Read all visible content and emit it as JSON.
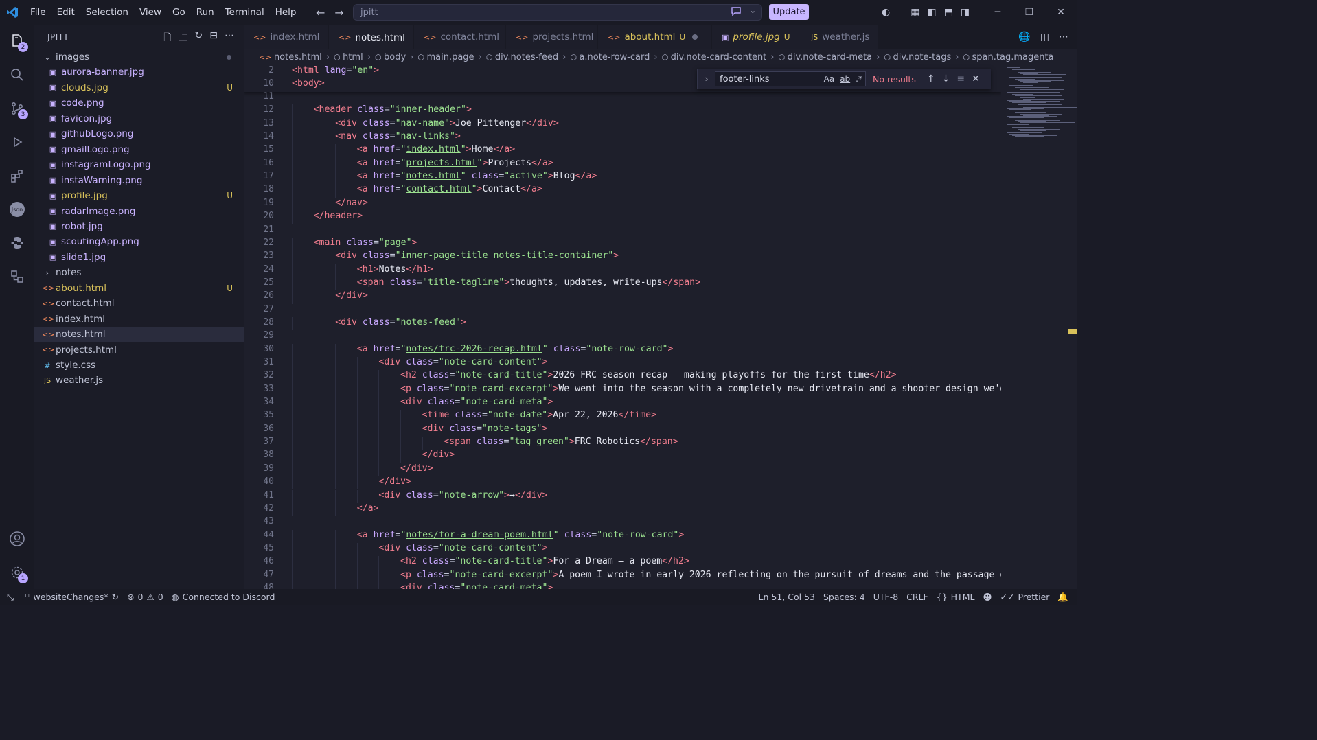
{
  "menu": [
    "File",
    "Edit",
    "Selection",
    "View",
    "Go",
    "Run",
    "Terminal",
    "Help"
  ],
  "command_center": {
    "text": "jpitt"
  },
  "update_label": "Update",
  "activity_badges": {
    "explorer": "2",
    "scm": "3",
    "settings": "1"
  },
  "sidebar": {
    "title": "JPITT",
    "items": [
      {
        "label": "images",
        "kind": "folder-open",
        "status": ""
      },
      {
        "label": "aurora-banner.jpg",
        "kind": "img",
        "status": ""
      },
      {
        "label": "clouds.jpg",
        "kind": "img",
        "status": "U"
      },
      {
        "label": "code.png",
        "kind": "img",
        "status": ""
      },
      {
        "label": "favicon.jpg",
        "kind": "img",
        "status": ""
      },
      {
        "label": "githubLogo.png",
        "kind": "img",
        "status": ""
      },
      {
        "label": "gmailLogo.png",
        "kind": "img",
        "status": ""
      },
      {
        "label": "instagramLogo.png",
        "kind": "img",
        "status": ""
      },
      {
        "label": "instaWarning.png",
        "kind": "img",
        "status": ""
      },
      {
        "label": "profile.jpg",
        "kind": "img",
        "status": "U"
      },
      {
        "label": "radarImage.png",
        "kind": "img",
        "status": ""
      },
      {
        "label": "robot.jpg",
        "kind": "img",
        "status": ""
      },
      {
        "label": "scoutingApp.png",
        "kind": "img",
        "status": ""
      },
      {
        "label": "slide1.jpg",
        "kind": "img",
        "status": ""
      },
      {
        "label": "notes",
        "kind": "folder",
        "status": ""
      },
      {
        "label": "about.html",
        "kind": "html",
        "status": "U"
      },
      {
        "label": "contact.html",
        "kind": "html",
        "status": ""
      },
      {
        "label": "index.html",
        "kind": "html",
        "status": ""
      },
      {
        "label": "notes.html",
        "kind": "html",
        "status": ""
      },
      {
        "label": "projects.html",
        "kind": "html",
        "status": ""
      },
      {
        "label": "style.css",
        "kind": "css",
        "status": ""
      },
      {
        "label": "weather.js",
        "kind": "js",
        "status": ""
      }
    ]
  },
  "tabs": [
    {
      "label": "index.html",
      "kind": "html",
      "state": ""
    },
    {
      "label": "notes.html",
      "kind": "html",
      "state": "modified"
    },
    {
      "label": "contact.html",
      "kind": "html",
      "state": ""
    },
    {
      "label": "projects.html",
      "kind": "html",
      "state": ""
    },
    {
      "label": "about.html",
      "kind": "html",
      "state": "U-dot"
    },
    {
      "label": "profile.jpg",
      "kind": "img",
      "state": "U"
    },
    {
      "label": "weather.js",
      "kind": "js",
      "state": ""
    }
  ],
  "breadcrumb": [
    "notes.html",
    "html",
    "body",
    "main.page",
    "div.notes-feed",
    "a.note-row-card",
    "div.note-card-content",
    "div.note-card-meta",
    "div.note-tags",
    "span.tag.magenta"
  ],
  "find": {
    "query": "footer-links",
    "opt_case": "Aa",
    "opt_word": "ab",
    "opt_regex": ".*",
    "result": "No results"
  },
  "sticky_lines": [
    {
      "num": "2",
      "html": "<span class=\"tag\">&lt;html</span> <span class=\"attr\">lang</span>=<span class=\"str\">\"en\"</span><span class=\"tag\">&gt;</span>"
    },
    {
      "num": "10",
      "html": "<span class=\"tag\">&lt;body&gt;</span>"
    }
  ],
  "code_lines": [
    {
      "num": "11",
      "indent": 0,
      "html": ""
    },
    {
      "num": "12",
      "indent": 1,
      "html": "<span class=\"tag\">&lt;header</span> <span class=\"attr\">class</span>=<span class=\"str\">\"inner-header\"</span><span class=\"tag\">&gt;</span>"
    },
    {
      "num": "13",
      "indent": 2,
      "html": "<span class=\"tag\">&lt;div</span> <span class=\"attr\">class</span>=<span class=\"str\">\"nav-name\"</span><span class=\"tag\">&gt;</span><span class=\"txt\">Joe Pittenger</span><span class=\"tag\">&lt;/div&gt;</span>"
    },
    {
      "num": "14",
      "indent": 2,
      "html": "<span class=\"tag\">&lt;nav</span> <span class=\"attr\">class</span>=<span class=\"str\">\"nav-links\"</span><span class=\"tag\">&gt;</span>"
    },
    {
      "num": "15",
      "indent": 3,
      "html": "<span class=\"tag\">&lt;a</span> <span class=\"attr\">href</span>=<span class=\"str\">\"<span class=\"link\">index.html</span>\"</span><span class=\"tag\">&gt;</span><span class=\"txt\">Home</span><span class=\"tag\">&lt;/a&gt;</span>"
    },
    {
      "num": "16",
      "indent": 3,
      "html": "<span class=\"tag\">&lt;a</span> <span class=\"attr\">href</span>=<span class=\"str\">\"<span class=\"link\">projects.html</span>\"</span><span class=\"tag\">&gt;</span><span class=\"txt\">Projects</span><span class=\"tag\">&lt;/a&gt;</span>"
    },
    {
      "num": "17",
      "indent": 3,
      "html": "<span class=\"tag\">&lt;a</span> <span class=\"attr\">href</span>=<span class=\"str\">\"<span class=\"link\">notes.html</span>\"</span> <span class=\"attr\">class</span>=<span class=\"str\">\"active\"</span><span class=\"tag\">&gt;</span><span class=\"txt\">Blog</span><span class=\"tag\">&lt;/a&gt;</span>"
    },
    {
      "num": "18",
      "indent": 3,
      "html": "<span class=\"tag\">&lt;a</span> <span class=\"attr\">href</span>=<span class=\"str\">\"<span class=\"link\">contact.html</span>\"</span><span class=\"tag\">&gt;</span><span class=\"txt\">Contact</span><span class=\"tag\">&lt;/a&gt;</span>"
    },
    {
      "num": "19",
      "indent": 2,
      "html": "<span class=\"tag\">&lt;/nav&gt;</span>"
    },
    {
      "num": "20",
      "indent": 1,
      "html": "<span class=\"tag\">&lt;/header&gt;</span>"
    },
    {
      "num": "21",
      "indent": 0,
      "html": ""
    },
    {
      "num": "22",
      "indent": 1,
      "html": "<span class=\"tag\">&lt;main</span> <span class=\"attr\">class</span>=<span class=\"str\">\"page\"</span><span class=\"tag\">&gt;</span>"
    },
    {
      "num": "23",
      "indent": 2,
      "html": "<span class=\"tag\">&lt;div</span> <span class=\"attr\">class</span>=<span class=\"str\">\"inner-page-title notes-title-container\"</span><span class=\"tag\">&gt;</span>"
    },
    {
      "num": "24",
      "indent": 3,
      "html": "<span class=\"tag\">&lt;h1&gt;</span><span class=\"txt\">Notes</span><span class=\"tag\">&lt;/h1&gt;</span>"
    },
    {
      "num": "25",
      "indent": 3,
      "html": "<span class=\"tag\">&lt;span</span> <span class=\"attr\">class</span>=<span class=\"str\">\"title-tagline\"</span><span class=\"tag\">&gt;</span><span class=\"txt\">thoughts, updates, write-ups</span><span class=\"tag\">&lt;/span&gt;</span>"
    },
    {
      "num": "26",
      "indent": 2,
      "html": "<span class=\"tag\">&lt;/div&gt;</span>"
    },
    {
      "num": "27",
      "indent": 0,
      "html": ""
    },
    {
      "num": "28",
      "indent": 2,
      "html": "<span class=\"tag\">&lt;div</span> <span class=\"attr\">class</span>=<span class=\"str\">\"notes-feed\"</span><span class=\"tag\">&gt;</span>"
    },
    {
      "num": "29",
      "indent": 0,
      "html": ""
    },
    {
      "num": "30",
      "indent": 3,
      "html": "<span class=\"tag\">&lt;a</span> <span class=\"attr\">href</span>=<span class=\"str\">\"<span class=\"link\">notes/frc-2026-recap.html</span>\"</span> <span class=\"attr\">class</span>=<span class=\"str\">\"note-row-card\"</span><span class=\"tag\">&gt;</span>"
    },
    {
      "num": "31",
      "indent": 4,
      "html": "<span class=\"tag\">&lt;div</span> <span class=\"attr\">class</span>=<span class=\"str\">\"note-card-content\"</span><span class=\"tag\">&gt;</span>"
    },
    {
      "num": "32",
      "indent": 5,
      "html": "<span class=\"tag\">&lt;h2</span> <span class=\"attr\">class</span>=<span class=\"str\">\"note-card-title\"</span><span class=\"tag\">&gt;</span><span class=\"txt\">2026 FRC season recap — making playoffs for the first time</span><span class=\"tag\">&lt;/h2&gt;</span>"
    },
    {
      "num": "33",
      "indent": 5,
      "html": "<span class=\"tag\">&lt;p</span> <span class=\"attr\">class</span>=<span class=\"str\">\"note-card-excerpt\"</span><span class=\"tag\">&gt;</span><span class=\"txt\">We went into the season with a completely new drivetrain and a shooter design we'd </span><span class=\"dim\">never tested</span>"
    },
    {
      "num": "34",
      "indent": 5,
      "html": "<span class=\"tag\">&lt;div</span> <span class=\"attr\">class</span>=<span class=\"str\">\"note-card-meta\"</span><span class=\"tag\">&gt;</span>"
    },
    {
      "num": "35",
      "indent": 6,
      "html": "<span class=\"tag\">&lt;time</span> <span class=\"attr\">class</span>=<span class=\"str\">\"note-date\"</span><span class=\"tag\">&gt;</span><span class=\"txt\">Apr 22, 2026</span><span class=\"tag\">&lt;/time&gt;</span>"
    },
    {
      "num": "36",
      "indent": 6,
      "html": "<span class=\"tag\">&lt;div</span> <span class=\"attr\">class</span>=<span class=\"str\">\"note-tags\"</span><span class=\"tag\">&gt;</span>"
    },
    {
      "num": "37",
      "indent": 7,
      "html": "<span class=\"tag\">&lt;span</span> <span class=\"attr\">class</span>=<span class=\"str\">\"tag green\"</span><span class=\"tag\">&gt;</span><span class=\"txt\">FRC Robotics</span><span class=\"tag\">&lt;/span&gt;</span>"
    },
    {
      "num": "38",
      "indent": 6,
      "html": "<span class=\"tag\">&lt;/div&gt;</span>"
    },
    {
      "num": "39",
      "indent": 5,
      "html": "<span class=\"tag\">&lt;/div&gt;</span>"
    },
    {
      "num": "40",
      "indent": 4,
      "html": "<span class=\"tag\">&lt;/div&gt;</span>"
    },
    {
      "num": "41",
      "indent": 4,
      "html": "<span class=\"tag\">&lt;div</span> <span class=\"attr\">class</span>=<span class=\"str\">\"note-arrow\"</span><span class=\"tag\">&gt;</span><span class=\"txt\">→</span><span class=\"tag\">&lt;/div&gt;</span>"
    },
    {
      "num": "42",
      "indent": 3,
      "html": "<span class=\"tag\">&lt;/a&gt;</span>"
    },
    {
      "num": "43",
      "indent": 0,
      "html": ""
    },
    {
      "num": "44",
      "indent": 3,
      "html": "<span class=\"tag\">&lt;a</span> <span class=\"attr\">href</span>=<span class=\"str\">\"<span class=\"link\">notes/for-a-dream-poem.html</span>\"</span> <span class=\"attr\">class</span>=<span class=\"str\">\"note-row-card\"</span><span class=\"tag\">&gt;</span>"
    },
    {
      "num": "45",
      "indent": 4,
      "html": "<span class=\"tag\">&lt;div</span> <span class=\"attr\">class</span>=<span class=\"str\">\"note-card-content\"</span><span class=\"tag\">&gt;</span>"
    },
    {
      "num": "46",
      "indent": 5,
      "html": "<span class=\"tag\">&lt;h2</span> <span class=\"attr\">class</span>=<span class=\"str\">\"note-card-title\"</span><span class=\"tag\">&gt;</span><span class=\"txt\">For a Dream — a poem</span><span class=\"tag\">&lt;/h2&gt;</span>"
    },
    {
      "num": "47",
      "indent": 5,
      "html": "<span class=\"tag\">&lt;p</span> <span class=\"attr\">class</span>=<span class=\"str\">\"note-card-excerpt\"</span><span class=\"tag\">&gt;</span><span class=\"txt\">A poem I wrote in early 2026 reflecting on the pursuit of dreams and the passage o</span><span class=\"dim\">f time.&lt;/p&gt;</span>"
    },
    {
      "num": "48",
      "indent": 5,
      "html": "<span class=\"tag\">&lt;div</span> <span class=\"attr\">class</span>=<span class=\"str\">\"note-card-meta\"</span><span class=\"tag\">&gt;</span>"
    }
  ],
  "status": {
    "branch": "websiteChanges*",
    "errors": "0",
    "warnings": "0",
    "discord": "Connected to Discord",
    "position": "Ln 51, Col 53",
    "spaces": "Spaces: 4",
    "encoding": "UTF-8",
    "eol": "CRLF",
    "language": "HTML",
    "formatter": "Prettier"
  }
}
